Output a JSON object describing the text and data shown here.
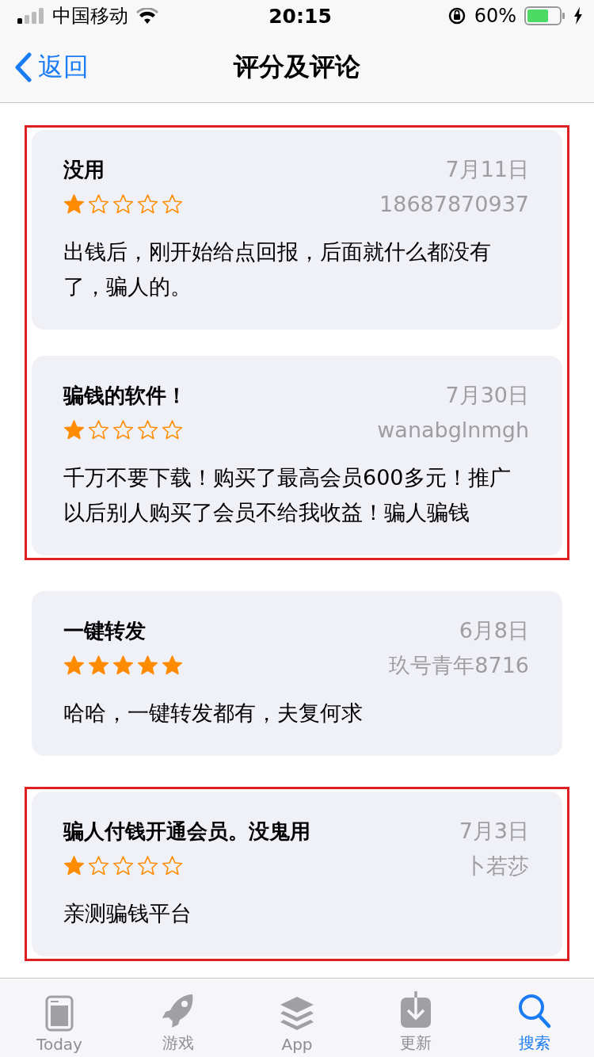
{
  "status_bar": {
    "carrier": "中国移动",
    "time": "20:15",
    "battery": "60%"
  },
  "nav": {
    "back": "返回",
    "title": "评分及评论"
  },
  "groups": [
    {
      "highlighted": true,
      "reviews": [
        {
          "title": "没用",
          "date": "7月11日",
          "stars": 1,
          "author": "18687870937",
          "body": "出钱后，刚开始给点回报，后面就什么都没有了，骗人的。"
        },
        {
          "title": "骗钱的软件！",
          "date": "7月30日",
          "stars": 1,
          "author": "wanabglnmgh",
          "body": "千万不要下载！购买了最高会员600多元！推广以后别人购买了会员不给我收益！骗人骗钱"
        }
      ]
    },
    {
      "highlighted": false,
      "reviews": [
        {
          "title": "一键转发",
          "date": "6月8日",
          "stars": 5,
          "author": "玖号青年8716",
          "body": "哈哈，一键转发都有，夫复何求"
        }
      ]
    },
    {
      "highlighted": true,
      "reviews": [
        {
          "title": "骗人付钱开通会员。没鬼用",
          "date": "7月3日",
          "stars": 1,
          "author": "卜若莎",
          "body": "亲测骗钱平台"
        }
      ]
    }
  ],
  "tabs": [
    {
      "kind": "today",
      "label": "Today",
      "selected": false
    },
    {
      "kind": "games",
      "label": "游戏",
      "selected": false
    },
    {
      "kind": "apps",
      "label": "App",
      "selected": false
    },
    {
      "kind": "updates",
      "label": "更新",
      "selected": false
    },
    {
      "kind": "search",
      "label": "搜索",
      "selected": true
    }
  ]
}
